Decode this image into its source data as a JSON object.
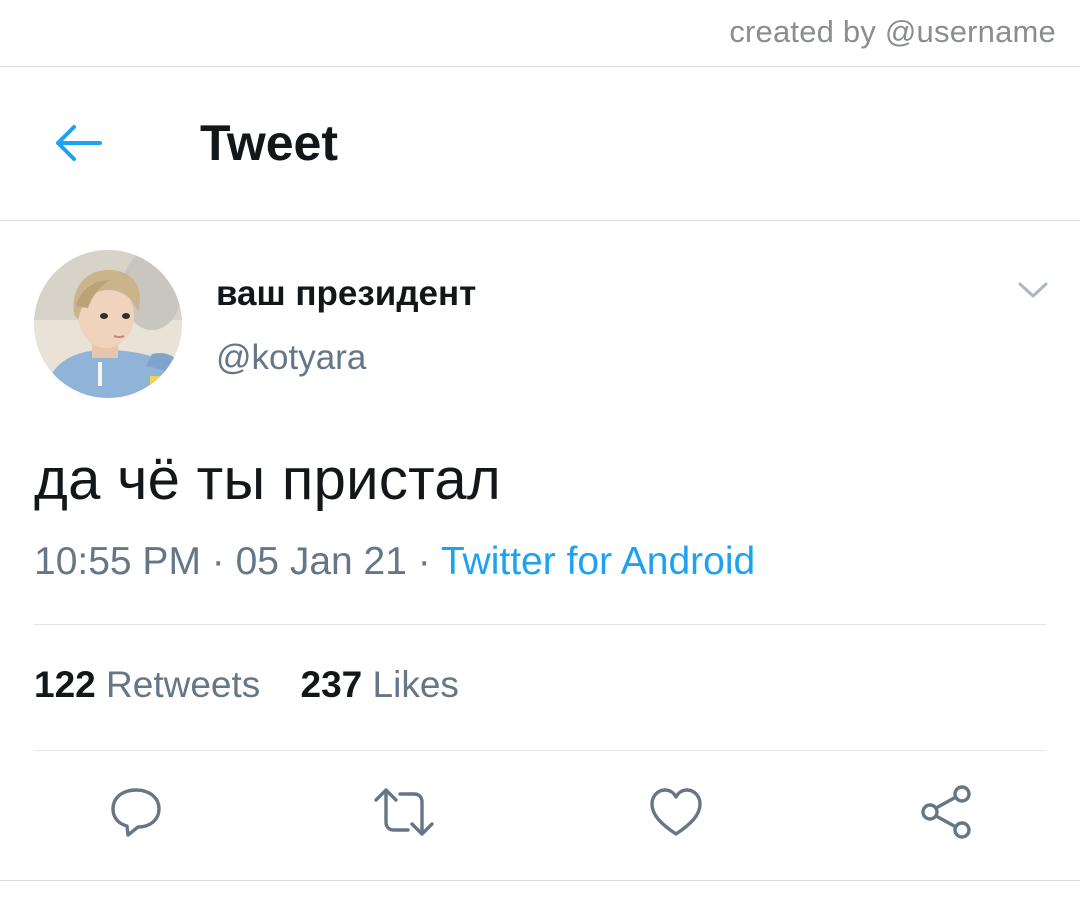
{
  "watermark": "created by @username",
  "header": {
    "title": "Tweet",
    "back_icon": "arrow-left-icon"
  },
  "author": {
    "display_name": "ваш президент",
    "handle": "@kotyara",
    "avatar": "avatar-photo"
  },
  "tweet": {
    "text": "да чё ты пристал",
    "time": "10:55 PM",
    "separator1": " · ",
    "date": "05 Jan 21",
    "separator2": " · ",
    "source": "Twitter for Android"
  },
  "stats": {
    "retweets_count": "122",
    "retweets_label": "Retweets",
    "likes_count": "237",
    "likes_label": "Likes"
  },
  "actions": [
    "reply-icon",
    "retweet-icon",
    "like-icon",
    "share-icon"
  ],
  "colors": {
    "accent": "#1da1f2",
    "text_primary": "#14171a",
    "text_secondary": "#657786",
    "icon_gray": "#657786",
    "divider": "#d9dde0"
  }
}
